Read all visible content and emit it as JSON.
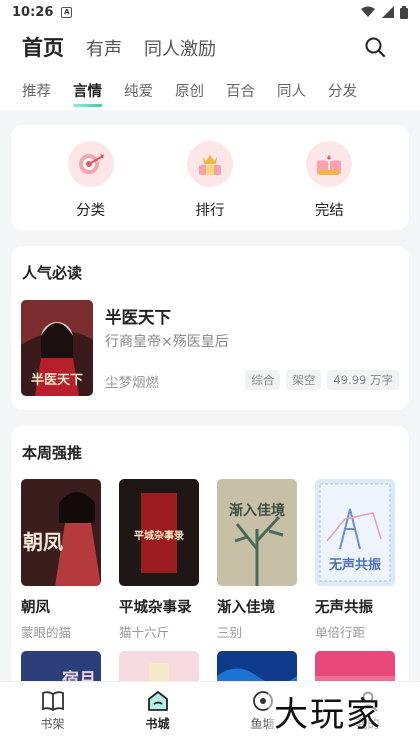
{
  "status": {
    "time": "10:26",
    "app_badge": "A"
  },
  "header": {
    "tabs": [
      {
        "label": "首页"
      },
      {
        "label": "有声"
      },
      {
        "label": "同人激励"
      }
    ],
    "subtabs": [
      "推荐",
      "言情",
      "纯爱",
      "原创",
      "百合",
      "同人",
      "分发"
    ],
    "active_subtab": "言情"
  },
  "quick_links": [
    {
      "label": "分类",
      "icon": "target-arrow-icon"
    },
    {
      "label": "排行",
      "icon": "crown-ranking-icon"
    },
    {
      "label": "完结",
      "icon": "open-book-icon"
    }
  ],
  "popular": {
    "title": "人气必读",
    "book": {
      "title": "半医天下",
      "description": "行商皇帝×殇医皇后",
      "author": "尘梦烟燃",
      "tags": [
        "综合",
        "架空",
        "49.99 万字"
      ],
      "cover_text": "半医天下"
    }
  },
  "weekly": {
    "title": "本周强推",
    "books": [
      {
        "title": "朝凤",
        "author": "蒙眼的猫",
        "cover_text": "朝凤"
      },
      {
        "title": "平城杂事录",
        "author": "猫十六斤",
        "cover_text": "平城杂事录"
      },
      {
        "title": "渐入佳境",
        "author": "三别",
        "cover_text": "渐入佳境"
      },
      {
        "title": "无声共振",
        "author": "单倍行距",
        "cover_text": "无声共振"
      }
    ],
    "row2_cover_text": [
      "宿月"
    ]
  },
  "nav": [
    {
      "label": "书架",
      "icon": "bookshelf-icon"
    },
    {
      "label": "书城",
      "icon": "bookstore-icon"
    },
    {
      "label": "鱼塘",
      "icon": "fishpond-icon"
    },
    {
      "label": "我的",
      "icon": "profile-icon"
    }
  ],
  "active_nav": "书城",
  "watermark": "大玩家",
  "colors": {
    "accent": "#41c7b3",
    "pink_bg": "#fde6e7"
  }
}
